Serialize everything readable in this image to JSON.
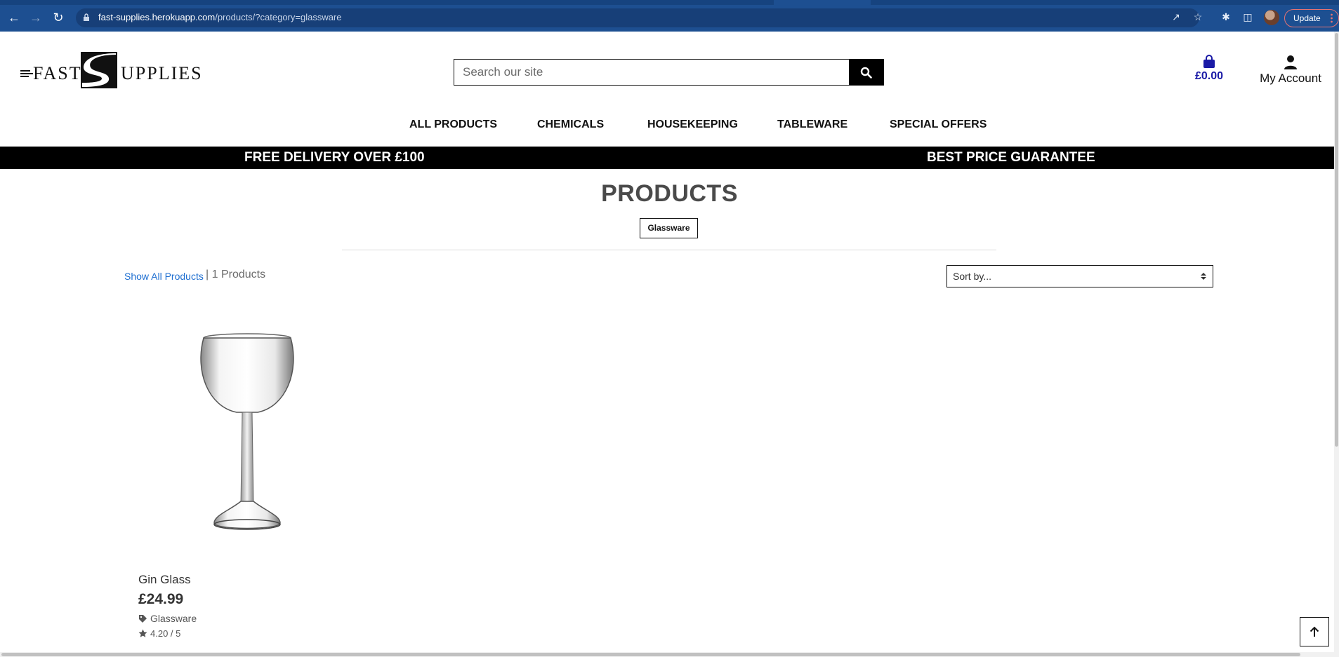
{
  "browser": {
    "url_host": "fast-supplies.herokuapp.com",
    "url_path": "/products/?category=glassware",
    "update_label": "Update"
  },
  "header": {
    "logo_fast": "FAST",
    "logo_s": "S",
    "logo_upplies": "UPPLIES",
    "search_placeholder": "Search our site",
    "bag_total": "£0.00",
    "account_label": "My Account"
  },
  "nav": {
    "items": [
      {
        "label": "ALL PRODUCTS"
      },
      {
        "label": "CHEMICALS"
      },
      {
        "label": "HOUSEKEEPING"
      },
      {
        "label": "TABLEWARE"
      },
      {
        "label": "SPECIAL OFFERS"
      }
    ]
  },
  "promo": {
    "left": "FREE DELIVERY OVER £100",
    "right": "BEST PRICE GUARANTEE"
  },
  "page": {
    "title": "PRODUCTS",
    "category_badge": "Glassware",
    "show_all_label": "Show All Products",
    "separator": "|",
    "count_label": "1 Products",
    "sort_placeholder": "Sort by..."
  },
  "products": [
    {
      "name": "Gin Glass",
      "price": "£24.99",
      "category": "Glassware",
      "rating": "4.20 / 5"
    }
  ],
  "colors": {
    "chrome": "#1d4f91",
    "price_blue": "#1a1aa6",
    "link_blue": "#1f6fd1",
    "promo_bar": "#000000"
  }
}
